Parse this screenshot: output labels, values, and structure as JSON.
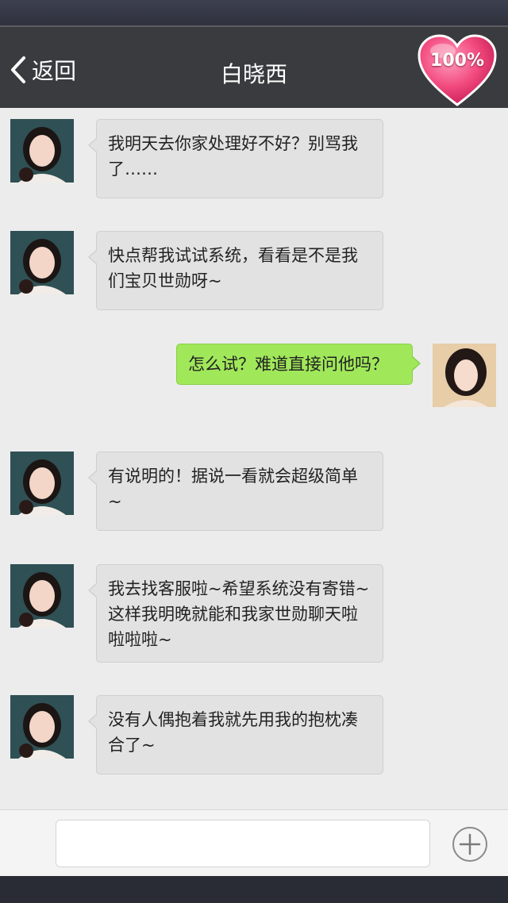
{
  "header": {
    "back_label": "返回",
    "title": "白晓西",
    "affinity": "100%"
  },
  "messages": [
    {
      "side": "left",
      "avatar": "woman-avatar",
      "text": "我明天去你家处理好不好？别骂我了……"
    },
    {
      "side": "left",
      "avatar": "woman-avatar",
      "text": "快点帮我试试系统，看看是不是我们宝贝世勋呀~"
    },
    {
      "side": "right",
      "avatar": "self-avatar",
      "text": "怎么试？难道直接问他吗？"
    },
    {
      "side": "left",
      "avatar": "woman-avatar",
      "text": "有说明的！据说一看就会超级简单~"
    },
    {
      "side": "left",
      "avatar": "woman-avatar",
      "text": "我去找客服啦~希望系统没有寄错~这样我明晚就能和我家世勋聊天啦啦啦啦~"
    },
    {
      "side": "left",
      "avatar": "woman-avatar",
      "text": "没有人偶抱着我就先用我的抱枕凑合了~"
    }
  ],
  "input": {
    "value": "",
    "placeholder": ""
  },
  "icons": {
    "back": "chevron-left-icon",
    "affinity": "heart-icon",
    "add": "plus-circle-icon"
  },
  "colors": {
    "header": "#3a3b3e",
    "incoming_bubble": "#e2e2e2",
    "outgoing_bubble": "#a0e85a",
    "heart": "#f24a7e"
  }
}
